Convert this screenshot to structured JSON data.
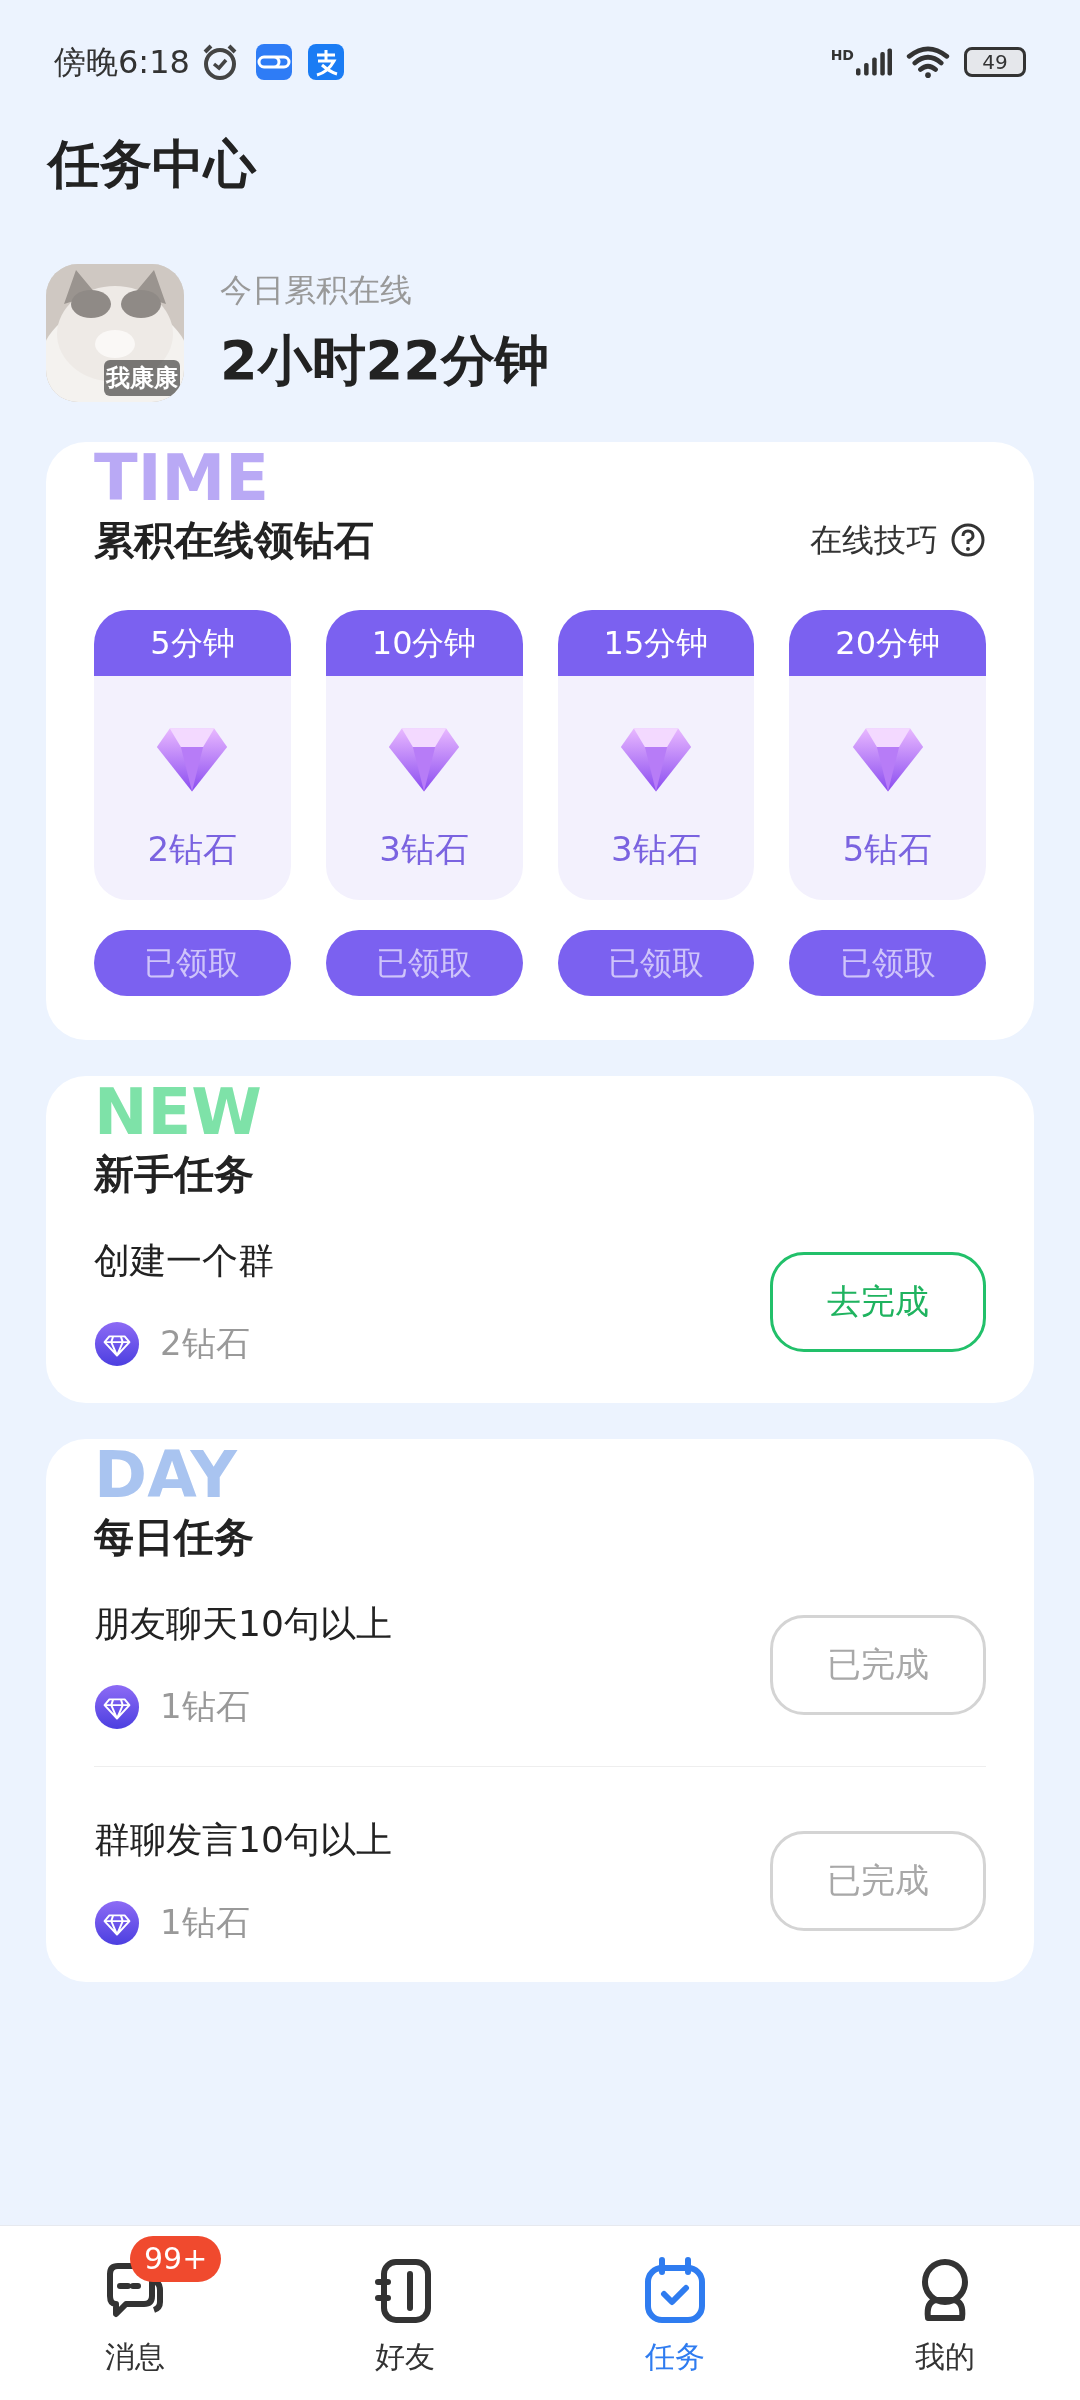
{
  "status_bar": {
    "time": "傍晚6:18",
    "signal_label": "HD",
    "battery": "49"
  },
  "title": "任务中心",
  "online": {
    "label": "今日累积在线",
    "duration": "2小时22分钟",
    "avatar_caption": "我康康"
  },
  "online_rewards": {
    "watermark": "TIME",
    "title": "累积在线领钻石",
    "tips": "在线技巧",
    "items": [
      {
        "time": "5分钟",
        "reward": "2钻石",
        "button": "已领取",
        "claimed": true
      },
      {
        "time": "10分钟",
        "reward": "3钻石",
        "button": "已领取",
        "claimed": true
      },
      {
        "time": "15分钟",
        "reward": "3钻石",
        "button": "已领取",
        "claimed": true
      },
      {
        "time": "20分钟",
        "reward": "5钻石",
        "button": "已领取",
        "claimed": true
      }
    ]
  },
  "sections": [
    {
      "watermark": "NEW",
      "title": "新手任务",
      "tasks": [
        {
          "name": "创建一个群",
          "reward": "2钻石",
          "button": "去完成",
          "done": false
        }
      ]
    },
    {
      "watermark": "DAY",
      "title": "每日任务",
      "tasks": [
        {
          "name": "朋友聊天10句以上",
          "reward": "1钻石",
          "button": "已完成",
          "done": true
        },
        {
          "name": "群聊发言10句以上",
          "reward": "1钻石",
          "button": "已完成",
          "done": true
        }
      ]
    }
  ],
  "bottom_nav": [
    {
      "label": "消息",
      "badge": "99+",
      "selected": false
    },
    {
      "label": "好友",
      "selected": false
    },
    {
      "label": "任务",
      "selected": true
    },
    {
      "label": "我的",
      "selected": false
    }
  ]
}
